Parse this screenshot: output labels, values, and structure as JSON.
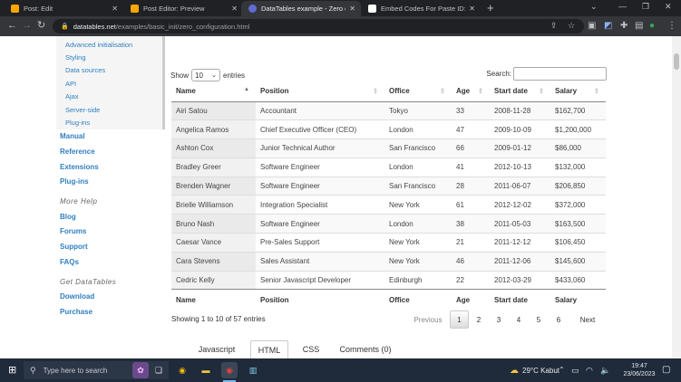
{
  "browser": {
    "tabs": [
      {
        "label": "Post: Edit",
        "favicon_color": "#f7a600"
      },
      {
        "label": "Post Editor: Preview",
        "favicon_color": "#f7a600"
      },
      {
        "label": "DataTables example - Zero confi",
        "favicon_color": "#5f6bd1"
      },
      {
        "label": "Embed Codes For Paste ID: Mvdl",
        "favicon_color": "#ffffff"
      }
    ],
    "active_tab": 2,
    "url_host": "datatables.net",
    "url_path": "/examples/basic_init/zero_configuration.html"
  },
  "sidebar": {
    "sub_items": [
      "Advanced initialisation",
      "Styling",
      "Data sources",
      "API",
      "Ajax",
      "Server-side",
      "Plug-ins"
    ],
    "main_items": [
      "Manual",
      "Reference",
      "Extensions",
      "Plug-ins"
    ],
    "more_help_heading": "More Help",
    "more_help_items": [
      "Blog",
      "Forums",
      "Support",
      "FAQs"
    ],
    "get_heading": "Get DataTables",
    "get_items": [
      "Download",
      "Purchase"
    ]
  },
  "table_controls": {
    "show_label": "Show",
    "page_length": "10",
    "entries_label": "entries",
    "search_label": "Search:",
    "search_value": ""
  },
  "table": {
    "columns": [
      "Name",
      "Position",
      "Office",
      "Age",
      "Start date",
      "Salary"
    ],
    "rows": [
      [
        "Airi Satou",
        "Accountant",
        "Tokyo",
        "33",
        "2008-11-28",
        "$162,700"
      ],
      [
        "Angelica Ramos",
        "Chief Executive Officer (CEO)",
        "London",
        "47",
        "2009-10-09",
        "$1,200,000"
      ],
      [
        "Ashton Cox",
        "Junior Technical Author",
        "San Francisco",
        "66",
        "2009-01-12",
        "$86,000"
      ],
      [
        "Bradley Greer",
        "Software Engineer",
        "London",
        "41",
        "2012-10-13",
        "$132,000"
      ],
      [
        "Brenden Wagner",
        "Software Engineer",
        "San Francisco",
        "28",
        "2011-06-07",
        "$206,850"
      ],
      [
        "Brielle Williamson",
        "Integration Specialist",
        "New York",
        "61",
        "2012-12-02",
        "$372,000"
      ],
      [
        "Bruno Nash",
        "Software Engineer",
        "London",
        "38",
        "2011-05-03",
        "$163,500"
      ],
      [
        "Caesar Vance",
        "Pre-Sales Support",
        "New York",
        "21",
        "2011-12-12",
        "$106,450"
      ],
      [
        "Cara Stevens",
        "Sales Assistant",
        "New York",
        "46",
        "2011-12-06",
        "$145,600"
      ],
      [
        "Cedric Kelly",
        "Senior Javascript Developer",
        "Edinburgh",
        "22",
        "2012-03-29",
        "$433,060"
      ]
    ],
    "info": "Showing 1 to 10 of 57 entries"
  },
  "pagination": {
    "previous": "Previous",
    "pages": [
      "1",
      "2",
      "3",
      "4",
      "5",
      "6"
    ],
    "current": "1",
    "next": "Next"
  },
  "code_tabs": {
    "items": [
      "Javascript",
      "HTML",
      "CSS",
      "Comments (0)"
    ],
    "active": "HTML"
  },
  "taskbar": {
    "search_placeholder": "Type here to search",
    "weather": "29°C  Kabut",
    "time": "19:47",
    "date": "23/06/2023"
  },
  "colors": {
    "link": "#2f7fc1",
    "chrome_dark": "#202124",
    "taskbar": "#1f2a3a"
  }
}
